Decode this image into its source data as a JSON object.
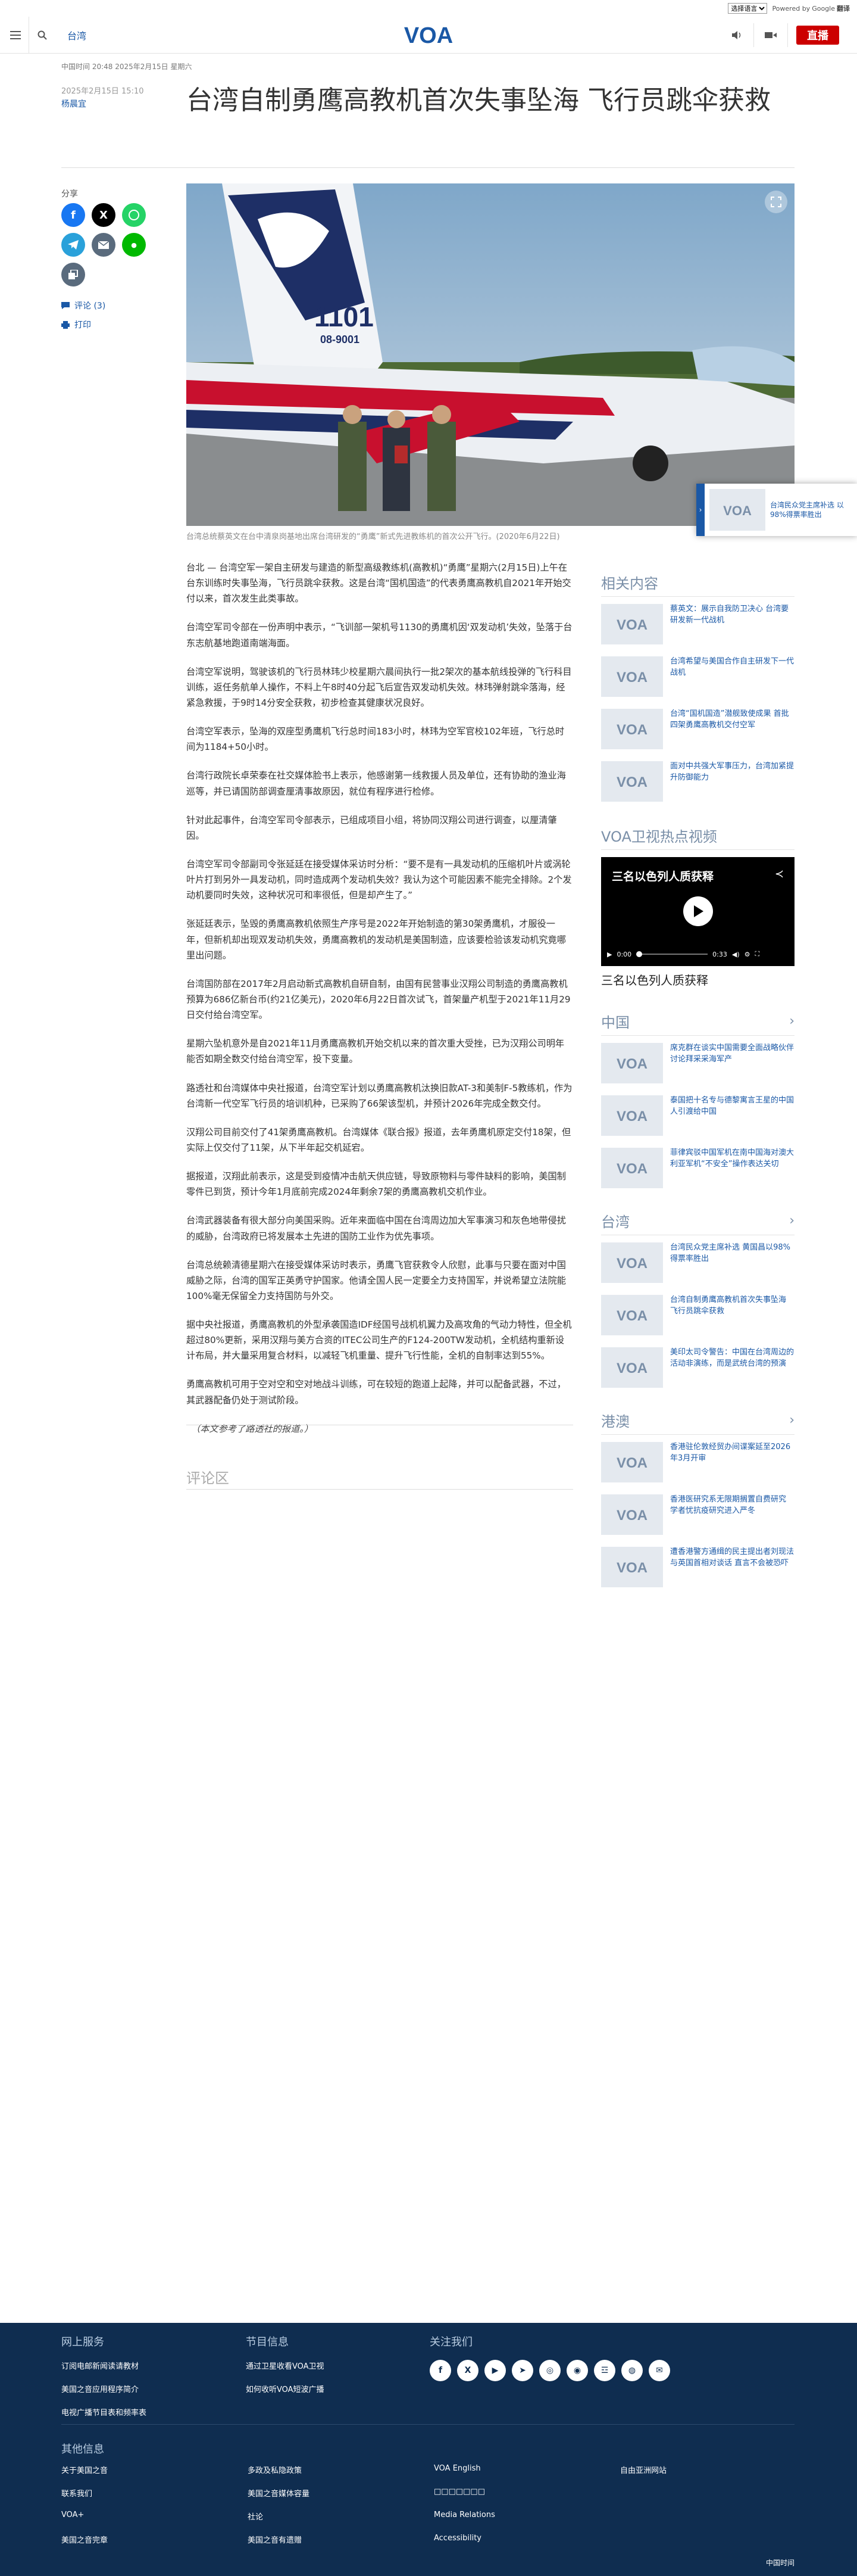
{
  "topbar": {
    "language_select": "选择语言",
    "google": "Google",
    "translate": "翻译",
    "powered": "Powered by"
  },
  "header": {
    "section": "台湾",
    "live": "直播",
    "logo": "VOA"
  },
  "article": {
    "updated": "中国时间 20:48 2025年2月15日 星期六",
    "date": "2025年2月15日 15:10",
    "author": "杨晨宜",
    "title": "台湾自制勇鹰高教机首次失事坠海 飞行员跳伞获救",
    "share_label": "分享",
    "comments_link": "评论 (3)",
    "print_link": "打印",
    "caption": "台湾总统蔡英文在台中清泉岗基地出席台湾研发的“勇鹰”新式先进教练机的首次公开飞行。(2020年6月22日)",
    "paragraphs": [
      "台北 — 台湾空军一架自主研发与建造的新型高级教练机(高教机)“勇鹰”星期六(2月15日)上午在台东训练时失事坠海，飞行员跳伞获救。这是台湾“国机国造”的代表勇鹰高教机自2021年开始交付以来，首次发生此类事故。",
      "台湾空军司令部在一份声明中表示，“飞训部一架机号1130的勇鹰机因‘双发动机’失效，坠落于台东志航基地跑道南端海面。",
      "台湾空军说明，驾驶该机的飞行员林玮少校星期六晨间执行一批2架次的基本航线投弹的飞行科目训练，返任务航单人操作，不料上午8时40分起飞后宣告双发动机失效。林玮弹射跳伞落海，经紧急救援，于9时14分安全获救，初步检查其健康状况良好。",
      "台湾空军表示，坠海的双座型勇鹰机飞行总时间183小时，林玮为空军官校102年班，飞行总时间为1184+50小时。",
      "台湾行政院长卓荣泰在社交媒体脸书上表示，他感谢第一线救援人员及单位，还有协助的渔业海巡等，并已请国防部调查厘清事故原因，就位有程序进行检修。",
      "针对此起事件，台湾空军司令部表示，已组成项目小组，将协同汉翔公司进行调查，以厘清肇因。",
      "台湾空军司令部副司令张延廷在接受媒体采访时分析：“要不是有一具发动机的压缩机叶片或涡轮叶片打到另外一具发动机，同时造成两个发动机失效？我认为这个可能因素不能完全排除。2个发动机要同时失效，这种状况可和率很低，但是却产生了。”",
      "张延廷表示，坠毁的勇鹰高教机依照生产序号是2022年开始制造的第30架勇鹰机，才服役一年，但新机却出现双发动机失效，勇鹰高教机的发动机是美国制造，应该要检验该发动机究竟哪里出问题。",
      "台湾国防部在2017年2月启动新式高教机自研自制，由国有民营事业汉翔公司制造的勇鹰高教机预算为686亿新台币(约21亿美元)，2020年6月22日首次试飞，首架量产机型于2021年11月29日交付给台湾空军。",
      "星期六坠机意外是自2021年11月勇鹰高教机开始交机以来的首次重大受挫，已为汉翔公司明年能否如期全数交付给台湾空军，投下变量。",
      "路透社和台湾媒体中央社报道，台湾空军计划以勇鹰高教机汰换旧款AT-3和美制F-5教练机，作为台湾新一代空军飞行员的培训机种，已采购了66架该型机，并预计2026年完成全数交付。",
      "汉翔公司目前交付了41架勇鹰高教机。台湾媒体《联合报》报道，去年勇鹰机原定交付18架，但实际上仅交付了11架，从下半年起交机延宕。",
      "据报道，汉翔此前表示，这是受到疫情冲击航天供应链，导致原物料与零件缺料的影响，美国制零件已到货，预计今年1月底前完成2024年剩余7架的勇鹰高教机交机作业。",
      "台湾武器装备有很大部分向美国采购。近年来面临中国在台湾周边加大军事演习和灰色地带侵扰的威胁，台湾政府已将发展本土先进的国防工业作为优先事项。",
      "台湾总统赖清德星期六在接受媒体采访时表示，勇鹰飞官获救令人欣慰，此事与只要在面对中国威胁之际，台湾的国军正英勇守护国家。他请全国人民一定要全力支持国军，并说希望立法院能100%毫无保留全力支持国防与外交。",
      "据中央社报道，勇鹰高教机的外型承袭国造IDF经国号战机机翼力及高攻角的气动力特性，但全机超过80%更新，采用汉翔与美方合资的ITEC公司生产的F124-200TW发动机，全机结构重新设计布局，并大量采用复合材料，以减轻飞机重量、提升飞行性能，全机的自制率达到55%。",
      "勇鹰高教机可用于空对空和空对地战斗训练，可在较短的跑道上起降，并可以配备武器，不过，其武器配备仍处于测试阶段。",
      "（本文参考了路透社的报道。）"
    ],
    "comments_heading": "评论区"
  },
  "sticky": {
    "text": "台湾民众党主席补选 以98%得票率胜出"
  },
  "sidebar": {
    "related": {
      "heading": "相关内容",
      "items": [
        "蔡英文：展示自我防卫决心 台湾要研发新一代战机",
        "台湾希望与美国合作自主研发下一代战机",
        "台湾“国机国造”潜舰致使成果 首批四架勇鹰高教机交付空军",
        "面对中共强大军事压力，台湾加紧提升防御能力"
      ]
    },
    "video": {
      "heading": "VOA卫视热点视频",
      "player_title": "三名以色列人质获释",
      "time_current": "0:00",
      "time_total": "0:33",
      "caption": "三名以色列人质获释"
    },
    "china": {
      "heading": "中国",
      "items": [
        "席克群在谈实中国需要全面战略伙伴 讨论拜采采海军产",
        "泰国把十名专与德黎寓言王星的中国人引渡给中国",
        "菲律宾驳中国军机在南中国海对澳大利亚军机“不安全”操作表达关切"
      ]
    },
    "taiwan": {
      "heading": "台湾",
      "items": [
        "台湾民众党主席补选 黄国昌以98%得票率胜出",
        "台湾自制勇鹰高教机首次失事坠海 飞行员跳伞获救",
        "美印太司令警告：中国在台湾周边的活动非演练，而是武统台湾的预演"
      ]
    },
    "hk": {
      "heading": "港澳",
      "items": [
        "香港驻伦敦经贸办间谍案延至2026年3月开审",
        "香港医研究系无限期搁置自费研究 学者忧抗疫研究进入严冬",
        "遭香港警方通缉的民主提出者刘现法与英国首相对谈话 直言不会被恐吓"
      ]
    }
  },
  "footer": {
    "col1": {
      "heading": "网上服务",
      "items": [
        "订阅电邮新闻读请教材",
        "美国之音应用程序简介",
        "电视广播节目表和频率表"
      ]
    },
    "col2": {
      "heading": "节目信息",
      "items": [
        "通过卫星收看VOA卫视",
        "如何收听VOA短波广播"
      ]
    },
    "col3": {
      "heading": "关注我们"
    },
    "social_icons": [
      "facebook-icon",
      "x-icon",
      "youtube-icon",
      "telegram-icon",
      "instagram-icon",
      "podcast-icon",
      "rss-icon",
      "podcast2-icon",
      "email-icon"
    ],
    "other": {
      "heading": "其他信息",
      "items": [
        "关于美国之音",
        "多政及私隐政策",
        "VOA English",
        "自由亚洲网站",
        "联系我们",
        "美国之音媒体容量",
        "□□□□□□□",
        "",
        "VOA+",
        "社论",
        "Media Relations",
        "",
        "美国之音完章",
        "美国之音有遗赠",
        "Accessibility",
        ""
      ]
    },
    "copyright": "中国时间"
  },
  "colors": {
    "brand_blue": "#1a58a6",
    "live_red": "#cc0000",
    "footer_bg": "#0f2d50"
  }
}
